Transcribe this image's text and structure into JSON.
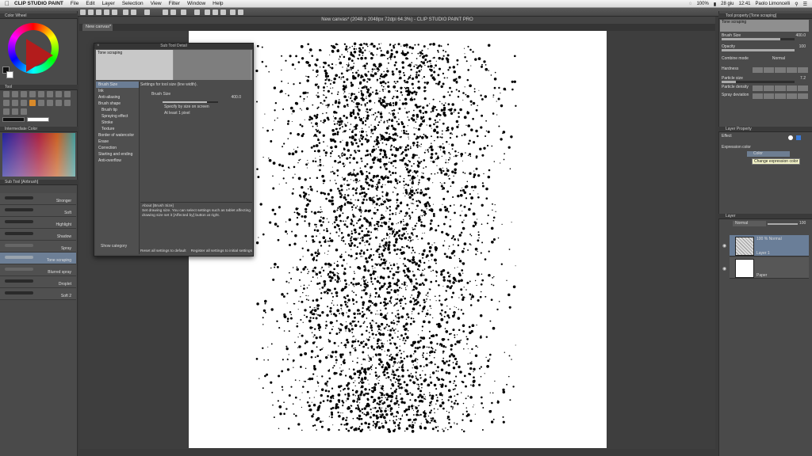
{
  "menubar": {
    "app_name": "CLIP STUDIO PAINT",
    "items": [
      "File",
      "Edit",
      "Layer",
      "Selection",
      "View",
      "Filter",
      "Window",
      "Help"
    ],
    "battery": "100%",
    "date": "28 giu",
    "time": "12:41",
    "user": "Paolo Limoncelli"
  },
  "window": {
    "title": "New canvas* (2048 x 2048px 72dpi 64.3%) - CLIP STUDIO PAINT PRO",
    "doc_tab": "New canvas*"
  },
  "left_panel": {
    "color_wheel_title": "Color Wheel",
    "tool_title": "Tool",
    "intermediate_title": "Intermediate Color",
    "subtool_title": "Sub Tool [Airbrush]",
    "subtools": [
      "Stronger",
      "Soft",
      "Highlight",
      "Shadow",
      "Spray",
      "Tone scraping",
      "Blurred spray",
      "Droplet",
      "Soft 2"
    ],
    "selected_subtool_index": 5,
    "main_color": "#111111",
    "sub_color": "#ffffff"
  },
  "dialog": {
    "title": "Sub Tool Detail",
    "preview_label": "Tone scraping",
    "categories": [
      "Brush Size",
      "Ink",
      "Anti-aliasing",
      "Brush shape",
      "Brush tip",
      "Spraying effect",
      "Stroke",
      "Texture",
      "Border of watercolor",
      "Erase",
      "Correction",
      "Starting and ending",
      "Anti-overflow"
    ],
    "sub_category_indexes": [
      4,
      5,
      6,
      7
    ],
    "selected_category_index": 0,
    "settings_header": "Settings for tool size (line width).",
    "brush_size_label": "Brush Size",
    "brush_size_value": "400.0",
    "brush_size_fraction": 0.8,
    "option_1": "Specify by size on screen",
    "option_2": "At least 1 pixel",
    "about_title": "About [Brush Size]",
    "about_text": "Set drawing size. You can select settings such as tablet affecting drawing size set it [Affected by] button at right.",
    "show_category": "Show category",
    "reset_button": "Reset all settings to default",
    "register_button": "Register all settings to initial settings"
  },
  "tool_property": {
    "title": "Tool property [Tone scraping]",
    "preview_label": "Tone scraping",
    "brush_size_label": "Brush Size",
    "brush_size_value": "400.0",
    "brush_size_fraction": 0.8,
    "opacity_label": "Opacity",
    "opacity_value": "100",
    "opacity_fraction": 1.0,
    "combine_label": "Combine mode",
    "combine_value": "Normal",
    "hardness_label": "Hardness",
    "particle_size_label": "Particle size",
    "particle_size_value": "7.2",
    "particle_density_label": "Particle density",
    "spray_deviation_label": "Spray deviation"
  },
  "layer_property": {
    "title": "Layer Property",
    "effect_label": "Effect",
    "expression_label": "Expression color",
    "color_value": "Color",
    "tooltip": "Change expression color"
  },
  "layer_panel": {
    "title": "Layer",
    "blend_mode": "Normal",
    "opacity": "100",
    "layers": [
      {
        "header": "100 % Normal",
        "name": "Layer 1"
      },
      {
        "header": "",
        "name": "Paper"
      }
    ]
  }
}
